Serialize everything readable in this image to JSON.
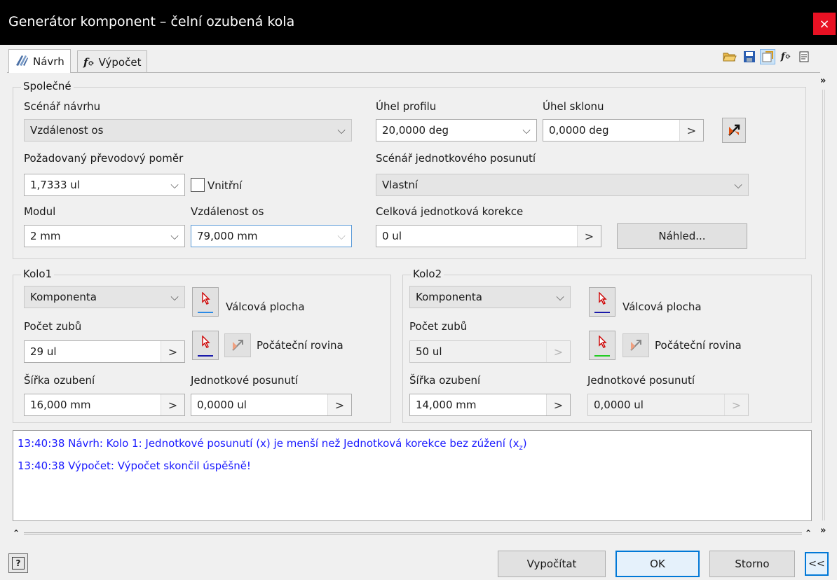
{
  "window": {
    "title": "Generátor komponent – čelní ozubená kola",
    "close": "×"
  },
  "tabs": [
    {
      "label": "Návrh",
      "icon": "design-icon",
      "active": true
    },
    {
      "label": "Výpočet",
      "icon": "calculation-icon",
      "active": false
    }
  ],
  "toolbar": {
    "icons": [
      "open-folder-icon",
      "save-icon",
      "properties-icon",
      "fx-icon",
      "notes-icon"
    ]
  },
  "common": {
    "group_title": "Společné",
    "design_scenario_label": "Scénář návrhu",
    "design_scenario_value": "Vzdálenost os",
    "ratio_label": "Požadovaný převodový poměr",
    "ratio_value": "1,7333 ul",
    "internal_label": "Vnitřní",
    "module_label": "Modul",
    "module_value": "2 mm",
    "center_distance_label": "Vzdálenost os",
    "center_distance_value": "79,000 mm",
    "profile_angle_label": "Úhel profilu",
    "profile_angle_value": "20,0000 deg",
    "helix_angle_label": "Úhel sklonu",
    "helix_angle_value": "0,0000 deg",
    "shift_scenario_label": "Scénář jednotkového posunutí",
    "shift_scenario_value": "Vlastní",
    "total_correction_label": "Celková jednotková korekce",
    "total_correction_value": "0 ul",
    "preview_button": "Náhled..."
  },
  "gear1": {
    "group_title": "Kolo1",
    "type_value": "Komponenta",
    "cylindrical_face_label": "Válcová plocha",
    "teeth_label": "Počet zubů",
    "teeth_value": "29 ul",
    "start_plane_label": "Počáteční rovina",
    "face_width_label": "Šířka ozubení",
    "face_width_value": "16,000 mm",
    "unit_shift_label": "Jednotkové posunutí",
    "unit_shift_value": "0,0000 ul"
  },
  "gear2": {
    "group_title": "Kolo2",
    "type_value": "Komponenta",
    "cylindrical_face_label": "Válcová plocha",
    "teeth_label": "Počet zubů",
    "teeth_value": "50 ul",
    "start_plane_label": "Počáteční rovina",
    "face_width_label": "Šířka ozubení",
    "face_width_value": "14,000 mm",
    "unit_shift_label": "Jednotkové posunutí",
    "unit_shift_value": "0,0000 ul"
  },
  "log": {
    "line1": "13:40:38 Návrh: Kolo 1: Jednotkové posunutí (x) je menší než Jednotková korekce bez zúžení (x",
    "line1_sub": "z",
    "line1_end": ")",
    "line2": "13:40:38 Výpočet: Výpočet skončil úspěšně!"
  },
  "footer": {
    "help": "?",
    "calculate": "Vypočítat",
    "ok": "OK",
    "cancel": "Storno",
    "collapse": "<<"
  },
  "colors": {
    "log_text": "#1a1aff",
    "gear1_face_bar": "#2b8ae6",
    "gear1_plane_bar": "#1a1aaa",
    "gear2_face_bar": "#1a1aaa",
    "gear2_plane_bar": "#22cc22",
    "accent": "#0078d7"
  }
}
